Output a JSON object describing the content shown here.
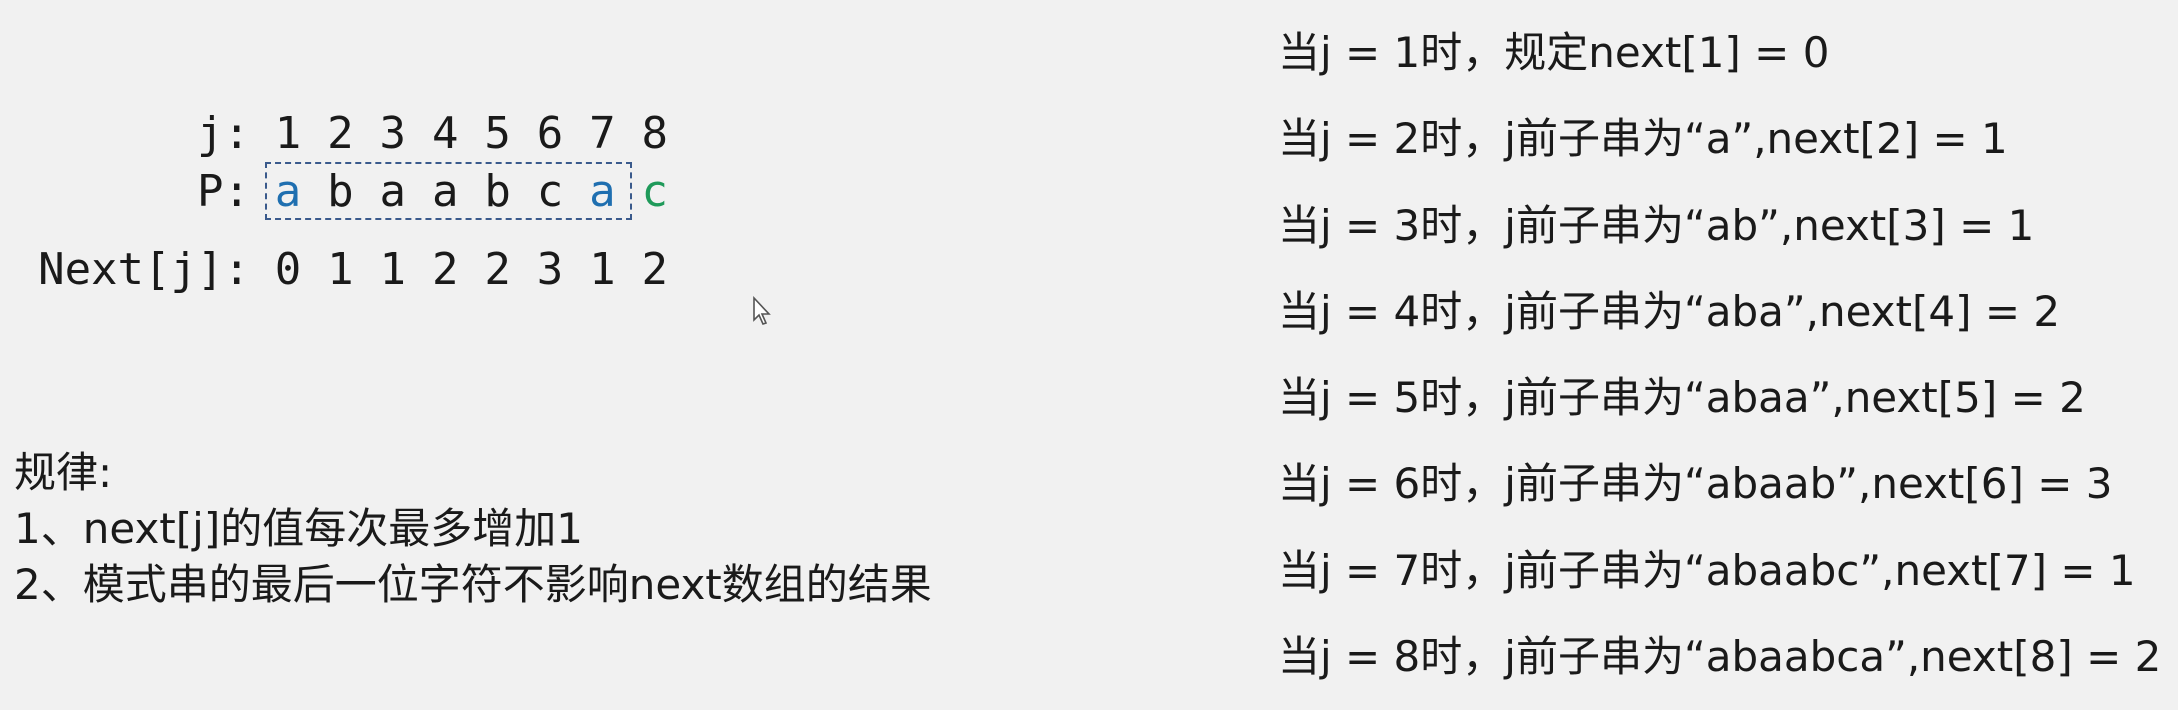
{
  "table": {
    "j_label": "j:",
    "j_values": [
      "1",
      "2",
      "3",
      "4",
      "5",
      "6",
      "7",
      "8"
    ],
    "p_label": "P:",
    "p_values": [
      "a",
      "b",
      "a",
      "a",
      "b",
      "c",
      "a",
      "c"
    ],
    "p_highlight": [
      "blue",
      "",
      "",
      "",
      "",
      "",
      "blue",
      "green"
    ],
    "next_label": "Next[j]:",
    "next_values": [
      "0",
      "1",
      "1",
      "2",
      "2",
      "3",
      "1",
      "2"
    ]
  },
  "rules": {
    "title": "规律:",
    "items": [
      "1、next[j]的值每次最多增加1",
      "2、模式串的最后一位字符不影响next数组的结果"
    ]
  },
  "steps": [
    "当j = 1时，规定next[1] = 0",
    "当j = 2时，j前子串为“a”,next[2] = 1",
    "当j = 3时，j前子串为“ab”,next[3] = 1",
    "当j = 4时，j前子串为“aba”,next[4] = 2",
    "当j = 5时，j前子串为“abaa”,next[5] = 2",
    "当j = 6时，j前子串为“abaab”,next[6] = 3",
    "当j = 7时，j前子串为“abaabc”,next[7] = 1",
    "当j = 8时，j前子串为“abaabca”,next[8] = 2"
  ],
  "colors": {
    "blue": "#1f6fb0",
    "green": "#1f9a5a",
    "dash": "#3a5a8c"
  }
}
